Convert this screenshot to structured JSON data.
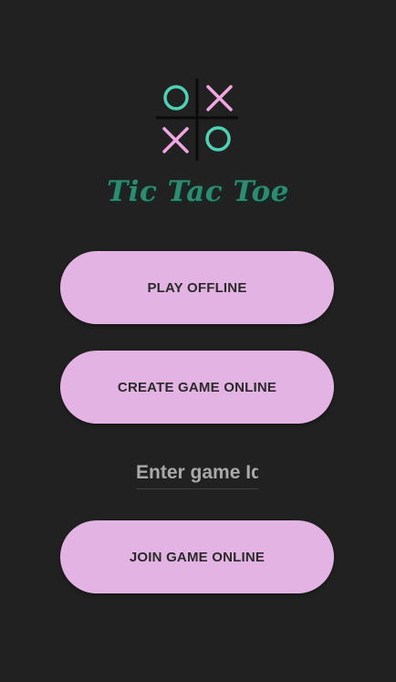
{
  "app": {
    "title": "Tic Tac Toe"
  },
  "logo": {
    "icon": "tic-tac-toe-board-icon",
    "cells": [
      "O",
      "X",
      "X",
      "O"
    ]
  },
  "buttons": {
    "play_offline": "PLAY OFFLINE",
    "create_online": "CREATE GAME ONLINE",
    "join_online": "JOIN GAME ONLINE"
  },
  "game_id_input": {
    "placeholder": "Enter game Id",
    "value": ""
  },
  "colors": {
    "background": "#212121",
    "button": "#e3b3e3",
    "title": "#2e8b72",
    "o_mark": "#4fd1b5",
    "x_mark": "#f0a6e0",
    "grid": "#000000"
  }
}
